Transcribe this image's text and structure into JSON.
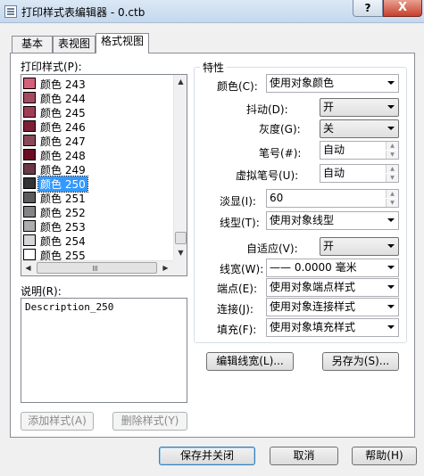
{
  "window": {
    "title": "打印样式表编辑器 - 0.ctb",
    "help_label": "?",
    "close_label": "X"
  },
  "tabs": [
    {
      "label": "基本"
    },
    {
      "label": "表视图"
    },
    {
      "label": "格式视图"
    }
  ],
  "styles": {
    "header": "打印样式(P):",
    "items": [
      {
        "label": "颜色 243",
        "color": "#d85f7a"
      },
      {
        "label": "颜色 244",
        "color": "#a54b60"
      },
      {
        "label": "颜色 245",
        "color": "#a33d54"
      },
      {
        "label": "颜色 246",
        "color": "#7e1f36"
      },
      {
        "label": "颜色 247",
        "color": "#8a4958"
      },
      {
        "label": "颜色 248",
        "color": "#6b0c23"
      },
      {
        "label": "颜色 249",
        "color": "#6a3945"
      },
      {
        "label": "颜色 250",
        "color": "#333333"
      },
      {
        "label": "颜色 251",
        "color": "#5b5b5b"
      },
      {
        "label": "颜色 252",
        "color": "#848484"
      },
      {
        "label": "颜色 253",
        "color": "#adadad"
      },
      {
        "label": "颜色 254",
        "color": "#d6d6d6"
      },
      {
        "label": "颜色 255",
        "color": "#ffffff"
      }
    ],
    "selected_index": 7
  },
  "description": {
    "label": "说明(R):",
    "value": "Description_250"
  },
  "buttons": {
    "add_style": "添加样式(A)",
    "delete_style": "删除样式(Y)",
    "edit_lineweights": "编辑线宽(L)...",
    "save_as": "另存为(S)...",
    "save_close": "保存并关闭",
    "cancel": "取消",
    "help": "帮助(H)"
  },
  "properties": {
    "title": "特性",
    "color": {
      "label": "颜色(C):",
      "value": "使用对象颜色"
    },
    "dither": {
      "label": "抖动(D):",
      "value": "开"
    },
    "grayscale": {
      "label": "灰度(G):",
      "value": "关"
    },
    "pen": {
      "label": "笔号(#):",
      "value": "自动"
    },
    "virtual_pen": {
      "label": "虚拟笔号(U):",
      "value": "自动"
    },
    "screening": {
      "label": "淡显(I):",
      "value": "60"
    },
    "linetype": {
      "label": "线型(T):",
      "value": "使用对象线型"
    },
    "adaptive": {
      "label": "自适应(V):",
      "value": "开"
    },
    "lineweight": {
      "label": "线宽(W):",
      "value": "—— 0.0000 毫米"
    },
    "line_end": {
      "label": "端点(E):",
      "value": "使用对象端点样式"
    },
    "line_join": {
      "label": "连接(J):",
      "value": "使用对象连接样式"
    },
    "fill": {
      "label": "填充(F):",
      "value": "使用对象填充样式"
    }
  },
  "colors": {
    "selection": "#3399ff",
    "close_button": "#c7402e"
  }
}
